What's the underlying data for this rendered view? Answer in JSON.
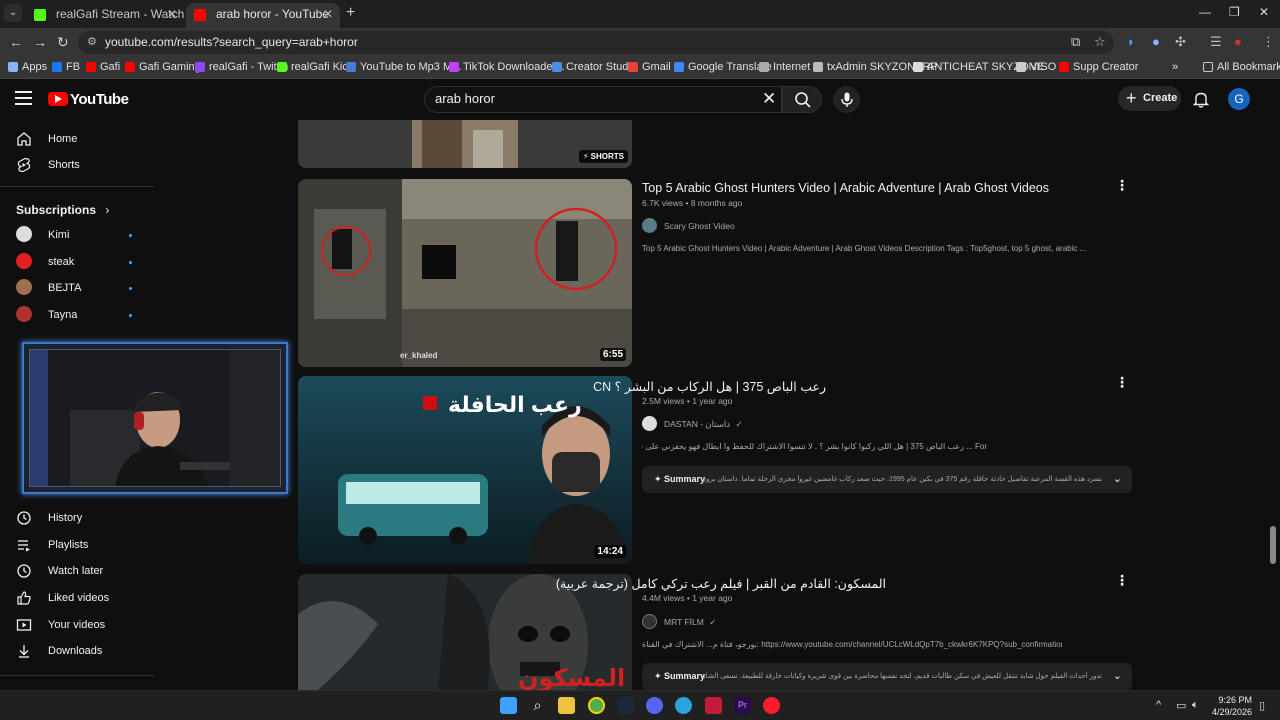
{
  "browser": {
    "tabs": [
      {
        "title": "realGafi Stream - Watch Live on",
        "favicon_color": "#53fc18"
      },
      {
        "title": "arab horor - YouTube",
        "favicon_color": "#ff0000"
      }
    ],
    "url": "youtube.com/results?search_query=arab+horor",
    "bookmarks": [
      {
        "label": "Apps",
        "color": "#8ab4f8"
      },
      {
        "label": "FB",
        "color": "#1877f2"
      },
      {
        "label": "Gafi",
        "color": "#ff0000"
      },
      {
        "label": "Gafi Gaming",
        "color": "#ff0000"
      },
      {
        "label": "realGafi - Twitch",
        "color": "#9146ff"
      },
      {
        "label": "realGafi Kick",
        "color": "#53fc18"
      },
      {
        "label": "YouTube to Mp3 M...",
        "color": "#4a7bd6"
      },
      {
        "label": "TikTok Downloader...",
        "color": "#c040ff"
      },
      {
        "label": "Creator Studio",
        "color": "#4a90e2"
      },
      {
        "label": "Gmail",
        "color": "#ea4335"
      },
      {
        "label": "Google Translate",
        "color": "#4285f4"
      },
      {
        "label": "Internet",
        "color": "#aaaaaa"
      },
      {
        "label": "txAdmin SKYZONERP",
        "color": "#bbbbbb"
      },
      {
        "label": "ANTICHEAT SKYZONE",
        "color": "#dddddd"
      },
      {
        "label": "VISO",
        "color": "#cccccc"
      },
      {
        "label": "Supp Creator",
        "color": "#ff0000"
      }
    ],
    "all_bookmarks": "All Bookmarks"
  },
  "youtube": {
    "logo_text": "YouTube",
    "search_value": "arab horor",
    "create_label": "Create",
    "avatar_letter": "G"
  },
  "sidebar": {
    "top_items": [
      {
        "label": "Home",
        "icon": "home-icon"
      },
      {
        "label": "Shorts",
        "icon": "shorts-icon"
      }
    ],
    "subscriptions_title": "Subscriptions",
    "subscriptions": [
      {
        "label": "Kimi",
        "color": "#dddddd"
      },
      {
        "label": "steak",
        "color": "#e02020"
      },
      {
        "label": "BEJTA",
        "color": "#a07050"
      },
      {
        "label": "Tayna",
        "color": "#b03030"
      }
    ],
    "you_items": [
      {
        "label": "History",
        "icon": "history-icon"
      },
      {
        "label": "Playlists",
        "icon": "playlists-icon"
      },
      {
        "label": "Watch later",
        "icon": "watch-later-icon"
      },
      {
        "label": "Liked videos",
        "icon": "liked-icon"
      },
      {
        "label": "Your videos",
        "icon": "your-videos-icon"
      },
      {
        "label": "Downloads",
        "icon": "downloads-icon"
      }
    ]
  },
  "results": {
    "shorts_badge": "SHORTS",
    "items": [
      {
        "title": "Top 5 Arabic Ghost Hunters Video | Arabic Adventure | Arab Ghost Videos",
        "meta": "6.7K views • 8 months ago",
        "channel": "Scary Ghost Video",
        "description": "Top 5 Arabic Ghost Hunters Video | Arabic Adventure | Arab Ghost Videos Description Tags : Top5ghost, top 5 ghost, arabic ...",
        "duration": "6:55",
        "thumb_text": "er_khaled"
      },
      {
        "title": "رعب الباص 375 | هل الركاب من البشر ؟ CN",
        "meta": "2.5M views • 1 year ago",
        "channel": "DASTAN - داستان",
        "description": "For ... رعب الباص 375 | هل اللي ركبوا كانوا بشر ؟ . لا تنسوا الاشتراك للحفظ وا ايطال فهو يحفزني على تقديم الأفضل ❤️ | . للاعلان",
        "summary_label": "Summary",
        "summary_text": "تسرد هذه القصة المرعبة تفاصيل حادثة حافلة رقم 375 في بكين عام 1995، حيث صعد ركاب غامضين غيروا مجرى الرحلة تماما. داستان يروي كيف...",
        "duration": "14:24",
        "thumb_text": "رعب الحافلة"
      },
      {
        "title": "المسكون: القادم من القبر | فيلم رعب تركي كامل (ترجمة عربية)",
        "meta": "4.4M views • 1 year ago",
        "channel": "MRT FİLM",
        "description": "بورجو، فتاة م... الاشتراك في القناة: https://www.youtube.com/channel/UCLcWLdQpT7b_ckwkr6K7KPQ?sub_confirmation=1 ...",
        "summary_label": "Summary",
        "summary_text": "تدور أحداث الفيلم حول شابة تنتقل للعيش في سكن طالبات قديم، لتجد نفسها محاصرة بين قوى شريرة وكيانات خارقة للطبيعة. تسعى الشابة للكشف عن أسرار...",
        "thumb_text": "المسكون"
      }
    ]
  },
  "taskbar": {
    "time": "9:26 PM",
    "date": "4/29/2026"
  }
}
